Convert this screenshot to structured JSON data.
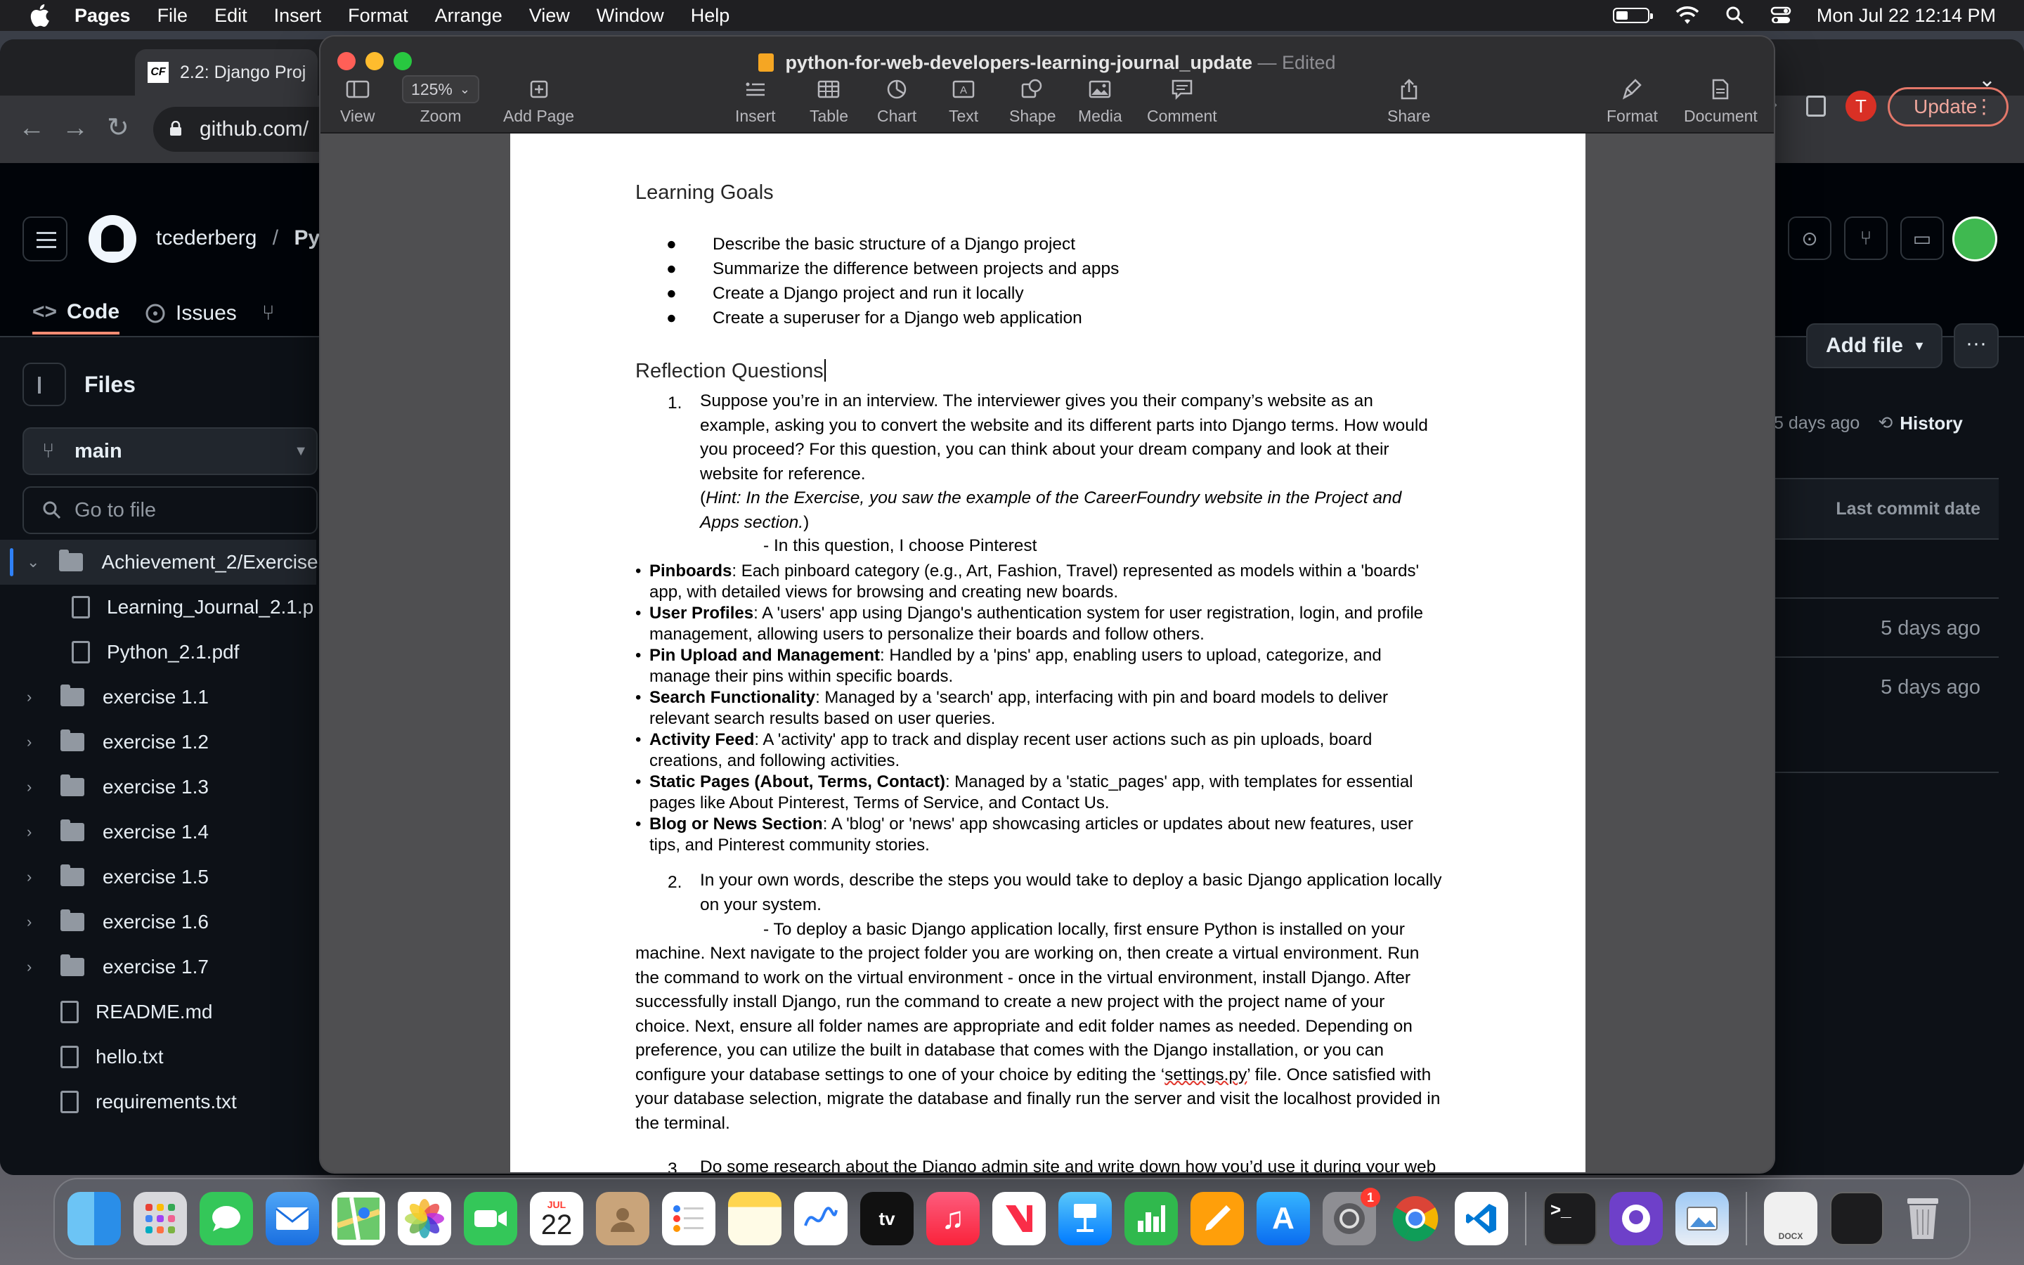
{
  "menubar": {
    "app_name": "Pages",
    "items": [
      "File",
      "Edit",
      "Insert",
      "Format",
      "Arrange",
      "View",
      "Window",
      "Help"
    ],
    "datetime": "Mon Jul 22  12:14 PM"
  },
  "browser": {
    "tab_title": "2.2: Django Proj",
    "tab_favicon": "CF",
    "url": "github.com/",
    "avatar_initial": "T",
    "update_label": "Update"
  },
  "github": {
    "owner": "tcederberg",
    "separator": "/",
    "repo_fragment": "Py",
    "tabs": [
      {
        "label": "Code"
      },
      {
        "label": "Issues"
      }
    ],
    "files_title": "Files",
    "branch": "main",
    "search_placeholder": "Go to file",
    "tree": [
      {
        "label": "Achievement_2/Exercise",
        "type": "folder",
        "open": true
      },
      {
        "label": "Learning_Journal_2.1.p",
        "type": "file",
        "indent": true
      },
      {
        "label": "Python_2.1.pdf",
        "type": "file",
        "indent": true
      },
      {
        "label": "exercise 1.1",
        "type": "folder"
      },
      {
        "label": "exercise 1.2",
        "type": "folder"
      },
      {
        "label": "exercise 1.3",
        "type": "folder"
      },
      {
        "label": "exercise 1.4",
        "type": "folder"
      },
      {
        "label": "exercise 1.5",
        "type": "folder"
      },
      {
        "label": "exercise 1.6",
        "type": "folder"
      },
      {
        "label": "exercise 1.7",
        "type": "folder"
      },
      {
        "label": "README.md",
        "type": "file"
      },
      {
        "label": "hello.txt",
        "type": "file"
      },
      {
        "label": "requirements.txt",
        "type": "file"
      }
    ],
    "add_file": "Add file",
    "more": "···",
    "history_ago": "5 days ago",
    "history_label": "History",
    "table_header": "Last commit date",
    "table_rows": [
      "",
      "5 days ago",
      "5 days ago"
    ]
  },
  "pages": {
    "doc_name": "python-for-web-developers-learning-journal_update",
    "doc_status": "— Edited",
    "toolbar": {
      "view": "View",
      "zoom_value": "125%",
      "zoom": "Zoom",
      "add_page": "Add Page",
      "insert": "Insert",
      "table": "Table",
      "chart": "Chart",
      "text": "Text",
      "shape": "Shape",
      "media": "Media",
      "comment": "Comment",
      "share": "Share",
      "format": "Format",
      "document": "Document"
    }
  },
  "document": {
    "learning_goals_heading": "Learning Goals",
    "goals": [
      "Describe the basic structure of a Django project",
      "Summarize the difference between projects and apps",
      "Create a Django project and run it locally",
      "Create a superuser for a Django web application"
    ],
    "reflection_heading": "Reflection Questions",
    "q1_num": "1.",
    "q1_lines": [
      "Suppose you’re in an interview. The interviewer gives you their company’s website as an",
      "example, asking you to convert the website and its different parts into Django terms. How would",
      "you proceed? For this question, you can think about your dream company and look at their",
      "website for reference."
    ],
    "q1_hint_open": "(",
    "q1_hint_line1": "Hint: In the Exercise, you saw the example of the CareerFoundry website in the Project and",
    "q1_hint_line2": "Apps section.",
    "q1_hint_close": ")",
    "q1_answer_intro": "- In this question, I choose Pinterest",
    "pinterest_points": [
      {
        "bold": "Pinboards",
        "rest": ": Each pinboard category (e.g., Art, Fashion, Travel) represented as models within a 'boards'",
        "line2": "app, with detailed views for browsing and creating new boards."
      },
      {
        "bold": "User Profiles",
        "rest": ": A 'users' app using Django's authentication system for user registration, login, and profile",
        "line2": "management, allowing users to personalize their boards and follow others."
      },
      {
        "bold": "Pin Upload and Management",
        "rest": ": Handled by a 'pins' app, enabling users to upload, categorize, and",
        "line2": "manage their pins within specific boards."
      },
      {
        "bold": "Search Functionality",
        "rest": ": Managed by a 'search' app, interfacing with pin and board models to deliver",
        "line2": "relevant search results based on user queries."
      },
      {
        "bold": "Activity Feed",
        "rest": ": A 'activity' app to track and display recent user actions such as pin uploads, board",
        "line2": "creations, and following activities."
      },
      {
        "bold": "Static Pages (About, Terms, Contact)",
        "rest": ": Managed by a 'static_pages' app, with templates for essential",
        "line2": "pages like About Pinterest, Terms of Service, and Contact Us."
      },
      {
        "bold": "Blog or News Section",
        "rest": ": A 'blog' or 'news' app showcasing articles or updates about new features, user",
        "line2": "tips, and Pinterest community stories."
      }
    ],
    "q2_num": "2.",
    "q2_lines": [
      "In your own words, describe the steps you would take to deploy a basic Django application locally",
      "on your system."
    ],
    "q2_answer_first": "- To deploy a basic Django application locally, first ensure Python is installed on your",
    "q2_answer_lines": [
      "machine. Next navigate to the project folder you are working on, then create a virtual environment. Run",
      "the command to work on the virtual environment - once in the virtual environment, install Django. After",
      "successfully install Django, run the command to create a new project with the project name of your",
      "choice. Next, ensure all folder names are appropriate and edit folder names as needed. Depending on",
      "preference, you can utilize the built in database that comes with the Django installation, or you can"
    ],
    "q2_settings_pre": "configure your database settings to one of your choice by editing the ‘",
    "q2_settings_file": "settings.py",
    "q2_settings_post": "’ file. Once satisfied with",
    "q2_answer_tail": [
      "your database selection, migrate the database and finally run the server and visit the localhost provided in",
      "the terminal."
    ],
    "q3_num": "3.",
    "q3_partial": "Do some research about the Django admin site and write down how you’d use it during your web"
  },
  "dock": {
    "calendar_month": "JUL",
    "calendar_day": "22",
    "settings_badge": "1",
    "apps": [
      "finder-icon",
      "launchpad-icon",
      "messages-icon",
      "mail-icon",
      "safari-icon",
      "photos-icon",
      "facetime-icon",
      "calendar-icon",
      "contacts-icon",
      "reminders-icon",
      "notes-icon",
      "freeform-icon",
      "tv-icon",
      "music-icon",
      "news-icon",
      "keynote-icon",
      "numbers-icon",
      "pages-icon",
      "app-store-icon",
      "system-settings-icon",
      "chrome-icon",
      "vscode-icon",
      "terminal-icon",
      "github-desktop-icon",
      "preview-icon",
      "docx-file-icon",
      "screenshot-icon",
      "trash-icon"
    ]
  }
}
